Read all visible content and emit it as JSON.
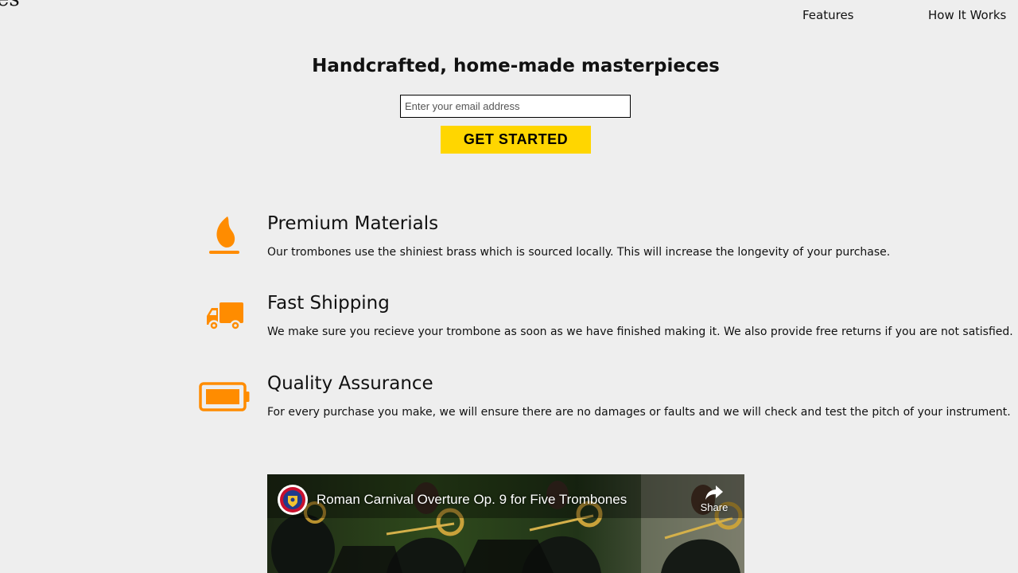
{
  "brand": {
    "text": "es"
  },
  "nav": {
    "features": "Features",
    "how_it_works": "How It Works"
  },
  "hero": {
    "title": "Handcrafted, home-made masterpieces",
    "email_placeholder": "Enter your email address",
    "email_value": "",
    "cta_label": "GET STARTED"
  },
  "colors": {
    "accent_icon": "#ff8c00",
    "cta": "#ffd600",
    "background": "#eeeeee"
  },
  "features": [
    {
      "icon": "flame-icon",
      "title": "Premium Materials",
      "description": "Our trombones use the shiniest brass which is sourced locally. This will increase the longevity of your purchase."
    },
    {
      "icon": "truck-icon",
      "title": "Fast Shipping",
      "description": "We make sure you recieve your trombone as soon as we have finished making it. We also provide free returns if you are not satisfied."
    },
    {
      "icon": "battery-icon",
      "title": "Quality Assurance",
      "description": "For every purchase you make, we will ensure there are no damages or faults and we will check and test the pitch of your instrument."
    }
  ],
  "video": {
    "title": "Roman Carnival Overture Op. 9 for Five Trombones",
    "share_label": "Share",
    "channel_icon": "channel-logo"
  }
}
